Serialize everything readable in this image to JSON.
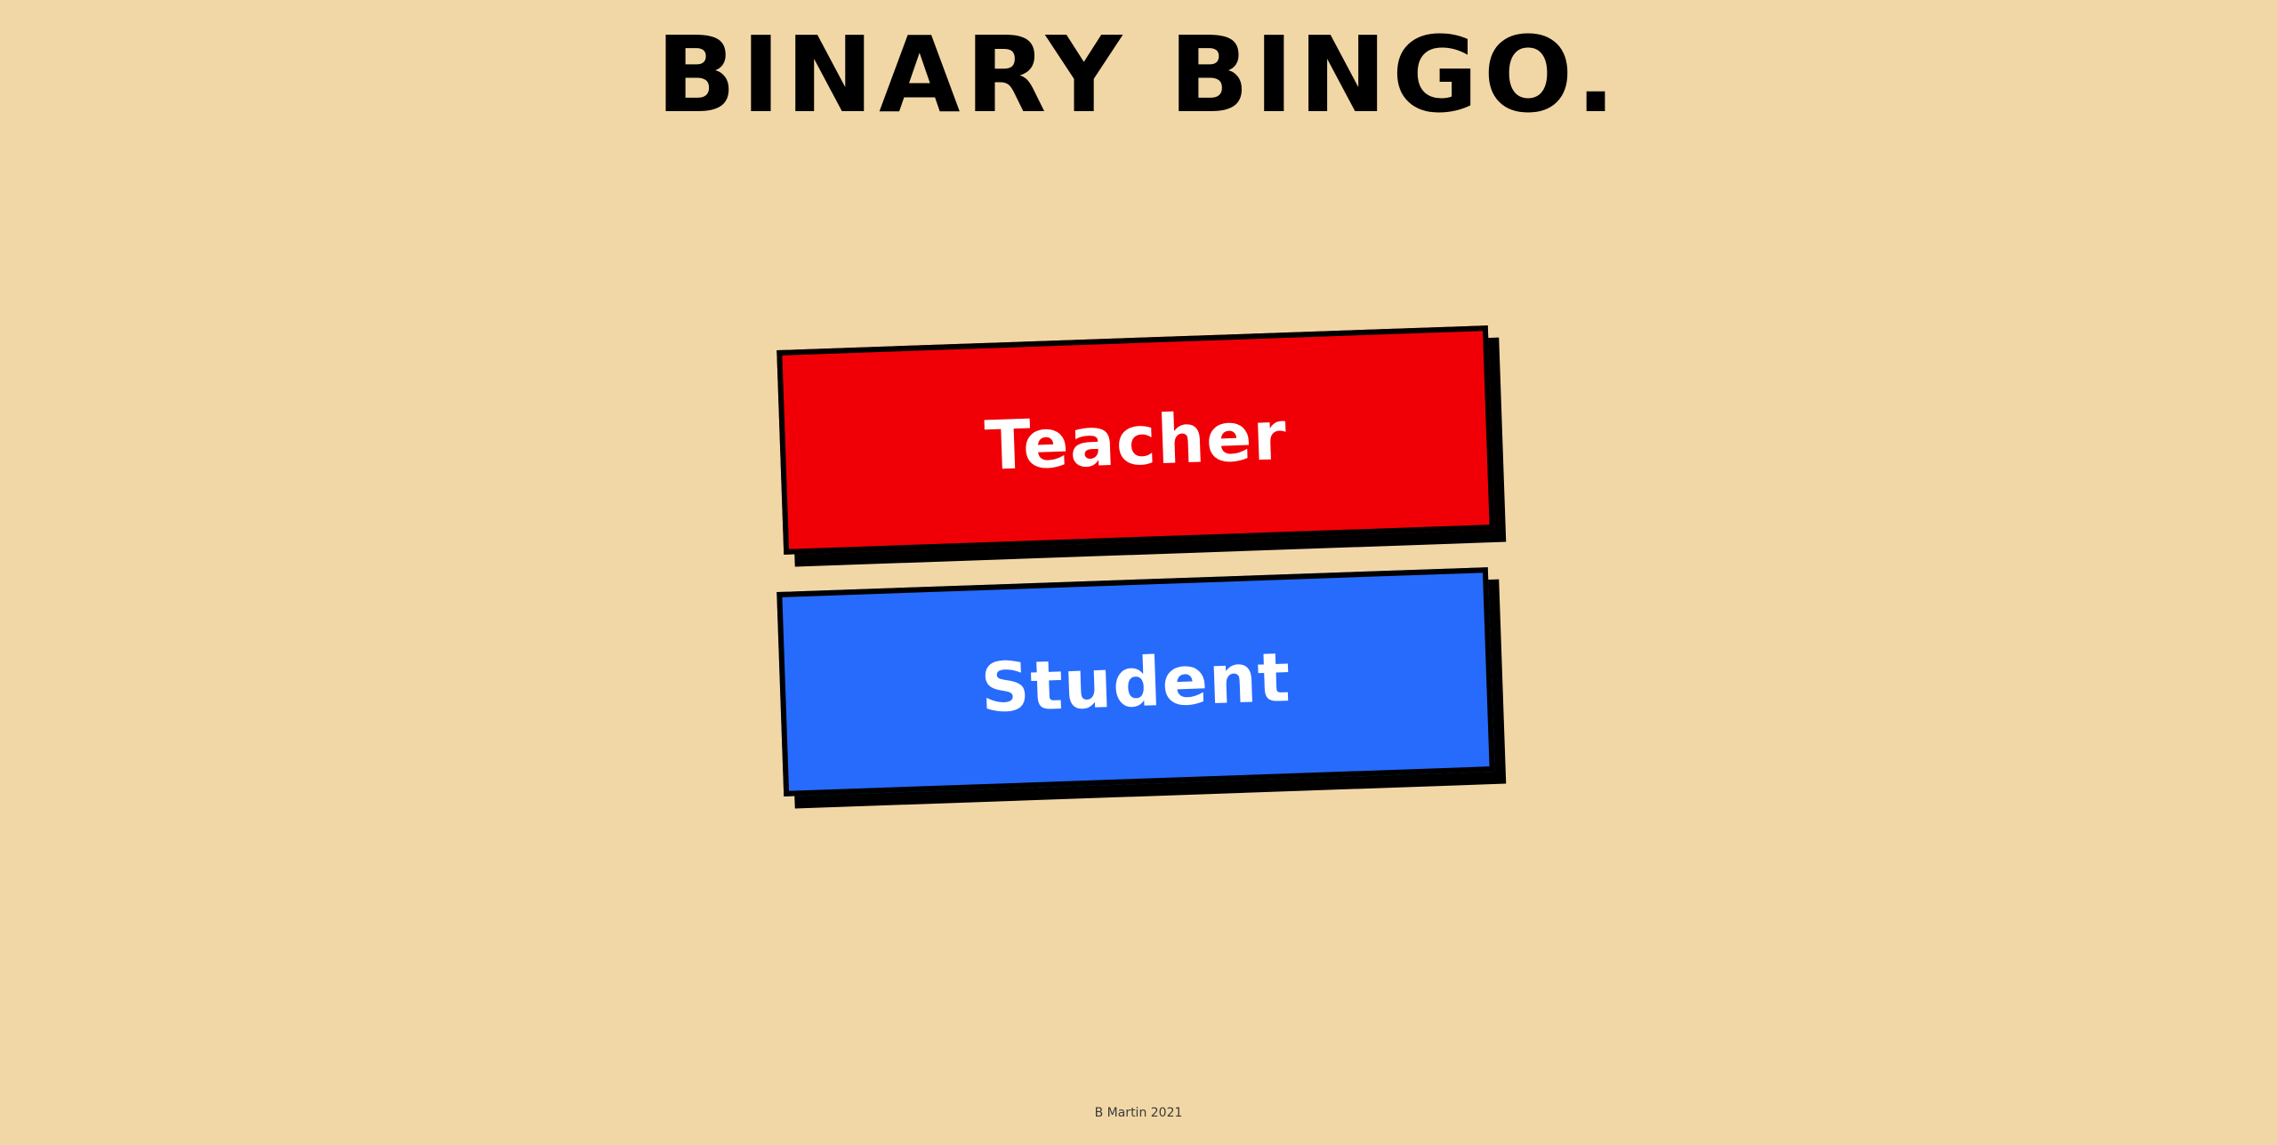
{
  "header": {
    "title": "BINARY BINGO."
  },
  "buttons": {
    "teacher_label": "Teacher",
    "student_label": "Student"
  },
  "footer": {
    "credit": "B Martin 2021"
  },
  "colors": {
    "background": "#f2d7a6",
    "teacher": "#f00006",
    "student": "#276bfd",
    "border": "#000000",
    "label": "#ffffff"
  }
}
